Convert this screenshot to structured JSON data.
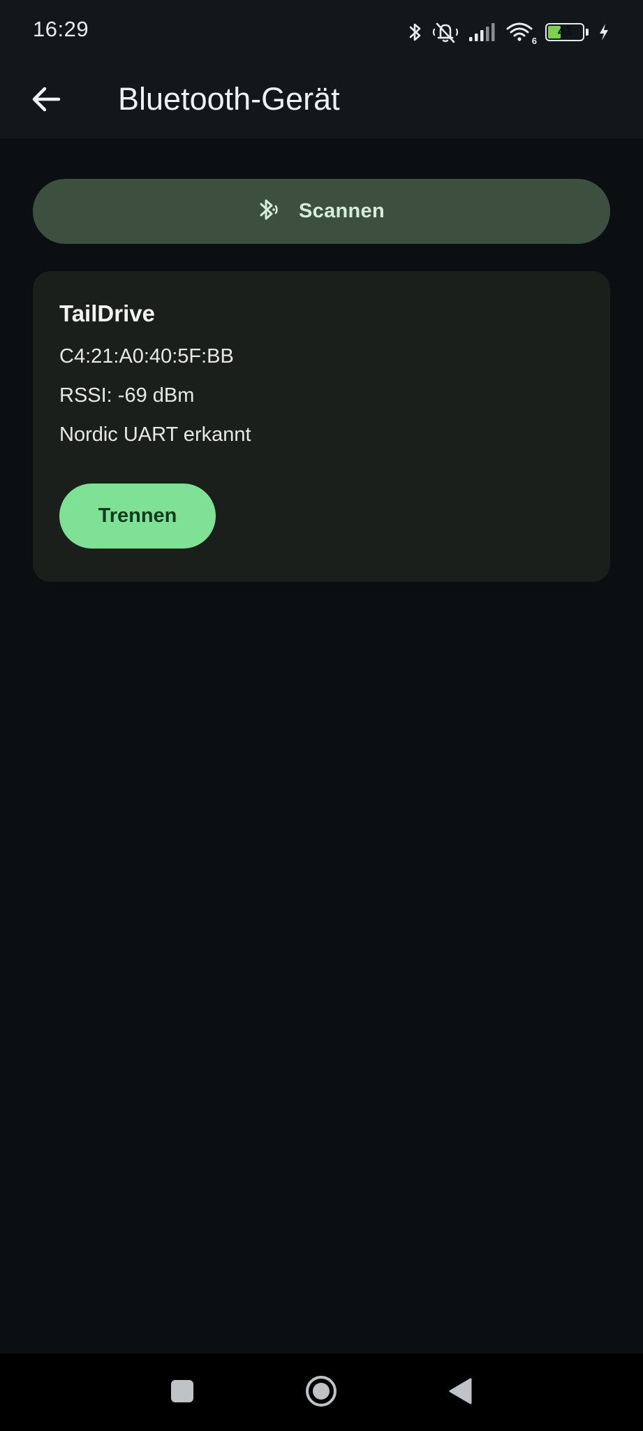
{
  "status_bar": {
    "time": "16:29",
    "battery_level": "43",
    "battery_fraction": 0.43,
    "wifi_badge": "6",
    "icons": [
      "bluetooth-icon",
      "muted-notifications-icon",
      "signal-icon",
      "wifi-icon",
      "battery-icon",
      "charging-icon"
    ]
  },
  "app_bar": {
    "title": "Bluetooth-Gerät",
    "back_icon": "arrow-back-icon"
  },
  "scan_button": {
    "label": "Scannen",
    "icon": "bluetooth-searching-icon"
  },
  "device": {
    "name": "TailDrive",
    "mac": "C4:21:A0:40:5F:BB",
    "rssi": "RSSI: -69 dBm",
    "uart_status": "Nordic UART erkannt",
    "disconnect_label": "Trennen"
  },
  "colors": {
    "background": "#0b0f12",
    "top_bar": "#12171b",
    "scan_button": "#3d5040",
    "card": "#1b1f1c",
    "accent_button": "#7fe195",
    "accent_button_text": "#0f3b1c",
    "battery_fill": "#7cd34b"
  },
  "nav_bar": {
    "items": [
      "recents-icon",
      "home-icon",
      "back-icon"
    ]
  }
}
